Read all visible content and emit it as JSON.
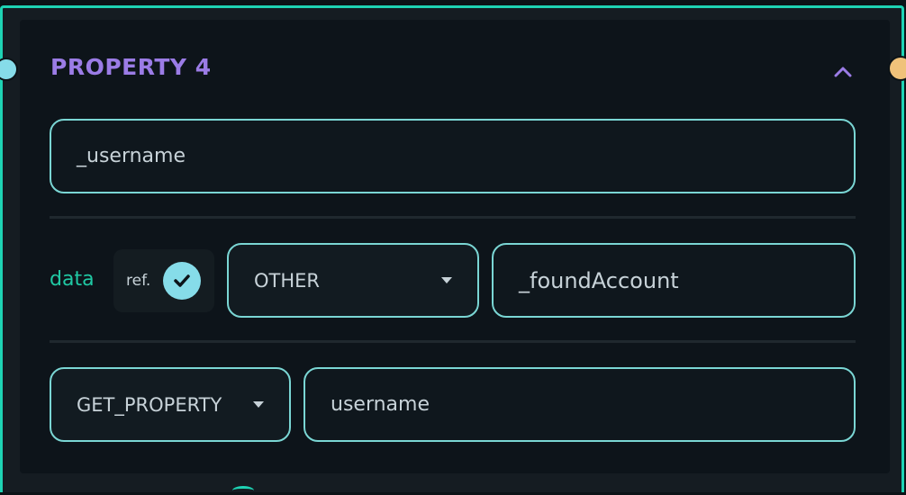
{
  "node": {
    "title": "PROPERTY 4",
    "name_value": "_username",
    "data_label": "data",
    "ref_label": "ref.",
    "ref_checked": true,
    "type_select": "OTHER",
    "value_field": "_foundAccount",
    "operation_select": "GET_PROPERTY",
    "property_field": "username"
  },
  "colors": {
    "border_accent": "#1ed3b4",
    "title": "#9b7ce6",
    "field_border": "#7ad6d4",
    "data_label": "#20c9a4",
    "port_left": "#86dce9",
    "port_right": "#f0c27a"
  }
}
